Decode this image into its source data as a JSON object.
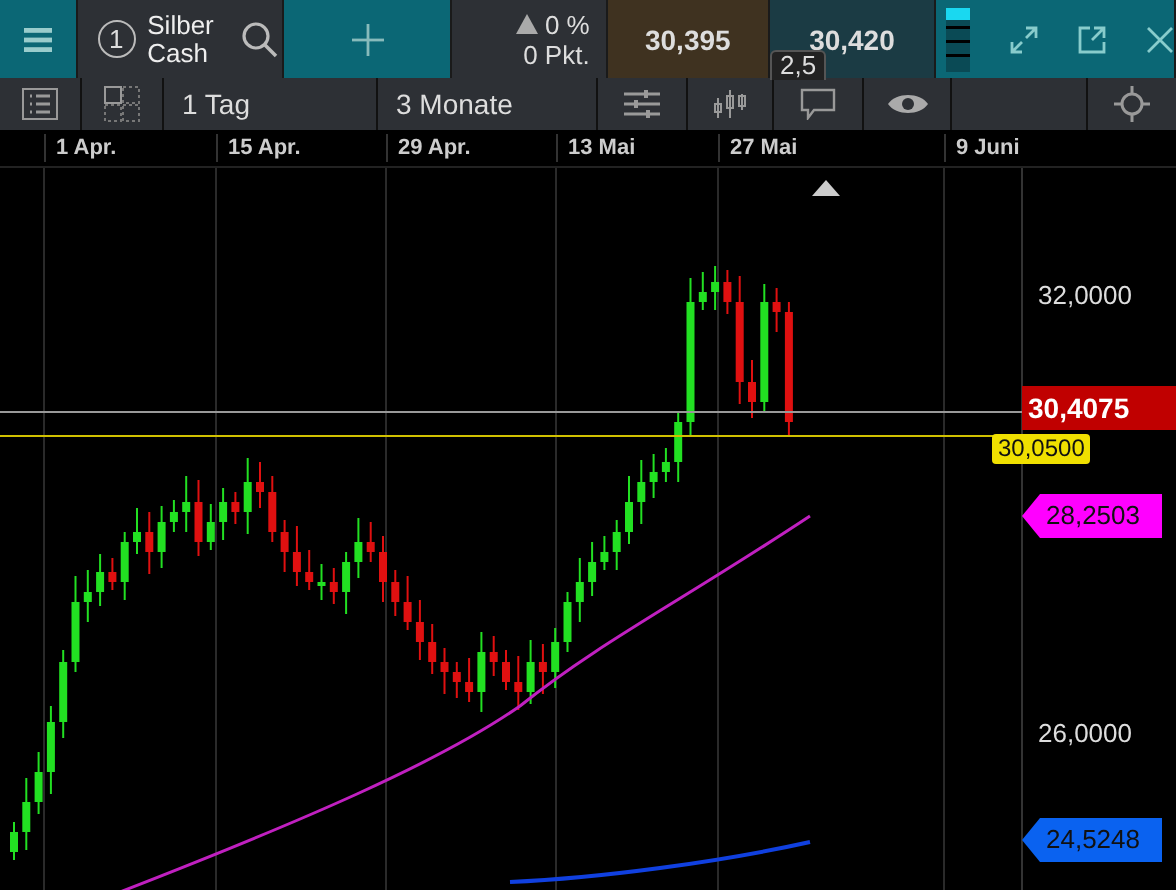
{
  "top_bar": {
    "instrument_number": "1",
    "instrument_name": "Silber Cash",
    "change_percent": "0 %",
    "change_points": "0 Pkt.",
    "sell_price": "30,395",
    "buy_price": "30,420",
    "spread": "2,5"
  },
  "toolbar": {
    "interval": "1 Tag",
    "range": "3 Monate"
  },
  "chart": {
    "date_labels": [
      "1 Apr.",
      "15 Apr.",
      "29 Apr.",
      "13 Mai",
      "27 Mai",
      "9 Juni"
    ],
    "price_labels": [
      "32,0000",
      "26,0000"
    ],
    "price_tags": [
      {
        "kind": "last",
        "value": "30,4075",
        "color": "#c00000"
      },
      {
        "kind": "alert",
        "value": "30,0500",
        "color": "#f0e000"
      },
      {
        "kind": "average",
        "value": "28,2503",
        "color": "#ff00ff"
      },
      {
        "kind": "average",
        "value": "24,5248",
        "color": "#0a62f0"
      }
    ]
  }
}
